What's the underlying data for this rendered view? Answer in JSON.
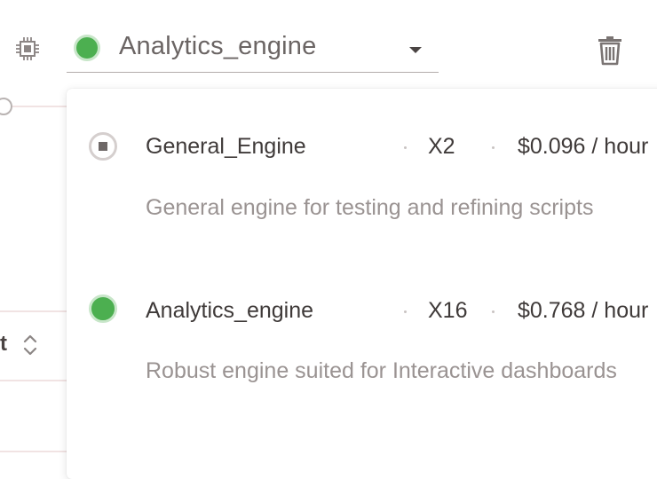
{
  "background": {
    "column_fragment": "t"
  },
  "selector": {
    "selected_label": "Analytics_engine",
    "selected_status_color": "#4caf50"
  },
  "engines": [
    {
      "name": "General_Engine",
      "size": "X2",
      "price": "$0.096 / hour",
      "description": "General engine for testing and refining scripts",
      "status": "stopped"
    },
    {
      "name": "Analytics_engine",
      "size": "X16",
      "price": "$0.768 / hour",
      "description": "Robust engine suited for Interactive dashboards",
      "status": "running"
    }
  ],
  "colors": {
    "running": "#4caf50",
    "running_ring": "#c8e6c9",
    "muted_text": "#9a9392"
  },
  "icons": [
    "cpu-icon",
    "chevron-down-icon",
    "trash-icon",
    "sort-icon"
  ]
}
